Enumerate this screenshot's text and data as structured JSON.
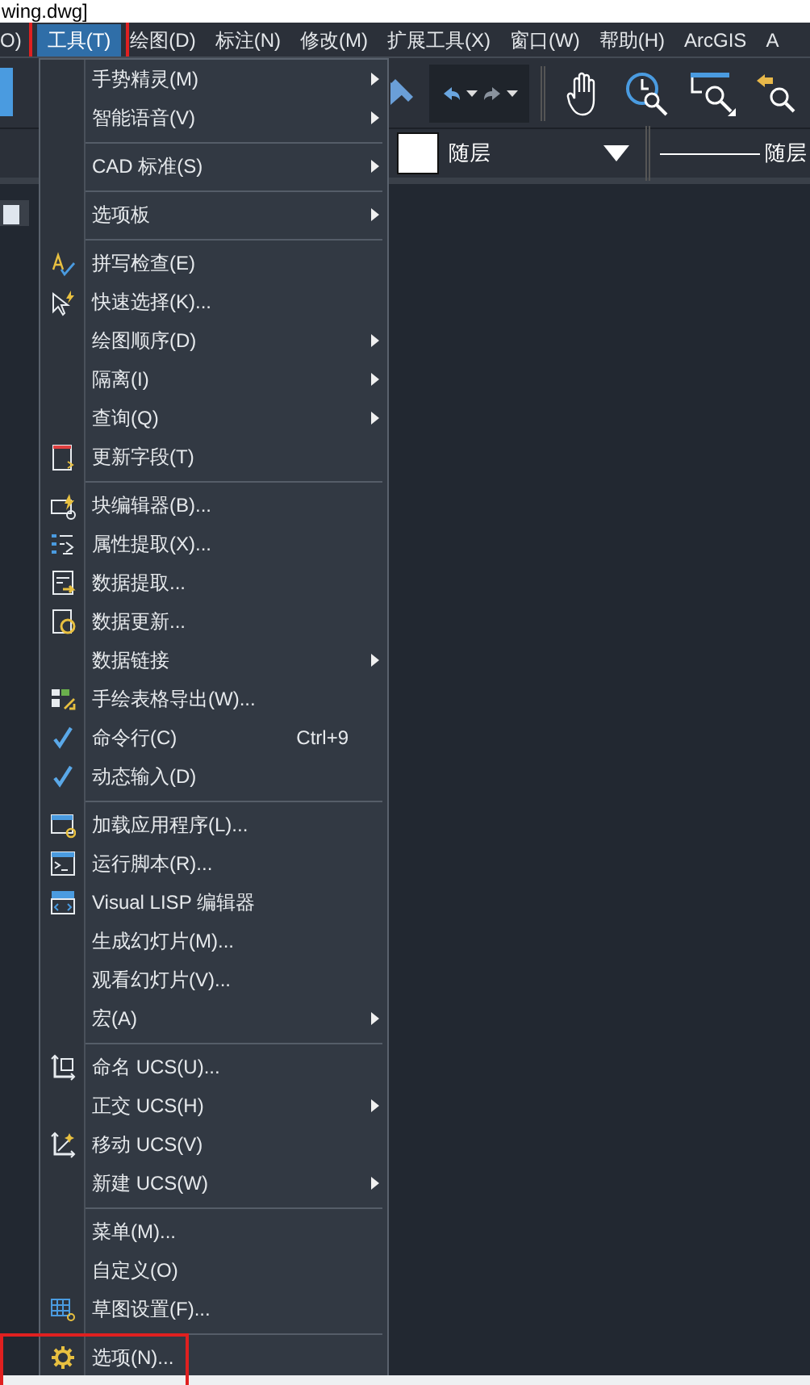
{
  "title_fragment": "wing.dwg]",
  "menubar": [
    {
      "label": "O)",
      "selected": false,
      "highlighted": false
    },
    {
      "label": "工具(T)",
      "selected": true,
      "highlighted": true
    },
    {
      "label": "绘图(D)",
      "selected": false,
      "highlighted": false
    },
    {
      "label": "标注(N)",
      "selected": false,
      "highlighted": false
    },
    {
      "label": "修改(M)",
      "selected": false,
      "highlighted": false
    },
    {
      "label": "扩展工具(X)",
      "selected": false,
      "highlighted": false
    },
    {
      "label": "窗口(W)",
      "selected": false,
      "highlighted": false
    },
    {
      "label": "帮助(H)",
      "selected": false,
      "highlighted": false
    },
    {
      "label": "ArcGIS",
      "selected": false,
      "highlighted": false
    },
    {
      "label": "A",
      "selected": false,
      "highlighted": false
    }
  ],
  "toolbar": {
    "layer_value": "随层",
    "linetype_value": "随层"
  },
  "menu": {
    "groups": [
      {
        "items": [
          {
            "kind": "text",
            "label": "手势精灵(M)",
            "submenu": true,
            "checked": false,
            "highlighted": false
          },
          {
            "kind": "text",
            "label": "智能语音(V)",
            "submenu": true,
            "checked": false,
            "highlighted": false
          }
        ]
      },
      {
        "items": [
          {
            "kind": "text",
            "label": "CAD 标准(S)",
            "submenu": true,
            "checked": false,
            "highlighted": false
          }
        ]
      },
      {
        "items": [
          {
            "kind": "text",
            "label": "选项板",
            "submenu": true,
            "checked": false,
            "highlighted": false
          }
        ]
      },
      {
        "items": [
          {
            "kind": "spell",
            "label": "拼写检查(E)",
            "submenu": false,
            "checked": false,
            "highlighted": false
          },
          {
            "kind": "cursor",
            "label": "快速选择(K)...",
            "submenu": false,
            "checked": false,
            "highlighted": false
          },
          {
            "kind": "text",
            "label": "绘图顺序(D)",
            "submenu": true,
            "checked": false,
            "highlighted": false
          },
          {
            "kind": "text",
            "label": "隔离(I)",
            "submenu": true,
            "checked": false,
            "highlighted": false
          },
          {
            "kind": "text",
            "label": "查询(Q)",
            "submenu": true,
            "checked": false,
            "highlighted": false
          },
          {
            "kind": "page",
            "label": "更新字段(T)",
            "submenu": false,
            "checked": false,
            "highlighted": false
          }
        ]
      },
      {
        "items": [
          {
            "kind": "block",
            "label": "块编辑器(B)...",
            "submenu": false,
            "checked": false,
            "highlighted": false
          },
          {
            "kind": "list",
            "label": "属性提取(X)...",
            "submenu": false,
            "checked": false,
            "highlighted": false
          },
          {
            "kind": "export",
            "label": "数据提取...",
            "submenu": false,
            "checked": false,
            "highlighted": false
          },
          {
            "kind": "refresh",
            "label": "数据更新...",
            "submenu": false,
            "checked": false,
            "highlighted": false
          },
          {
            "kind": "text",
            "label": "数据链接",
            "submenu": true,
            "checked": false,
            "highlighted": false
          },
          {
            "kind": "table",
            "label": "手绘表格导出(W)...",
            "submenu": false,
            "checked": false,
            "highlighted": false
          },
          {
            "kind": "text",
            "label": "命令行(C)",
            "shortcut": "Ctrl+9",
            "submenu": false,
            "checked": true,
            "highlighted": false
          },
          {
            "kind": "text",
            "label": "动态输入(D)",
            "submenu": false,
            "checked": true,
            "highlighted": false
          }
        ]
      },
      {
        "items": [
          {
            "kind": "app",
            "label": "加载应用程序(L)...",
            "submenu": false,
            "checked": false,
            "highlighted": false
          },
          {
            "kind": "console",
            "label": "运行脚本(R)...",
            "submenu": false,
            "checked": false,
            "highlighted": false
          },
          {
            "kind": "lisp",
            "label": "Visual LISP 编辑器",
            "submenu": false,
            "checked": false,
            "highlighted": false
          },
          {
            "kind": "text",
            "label": "生成幻灯片(M)...",
            "submenu": false,
            "checked": false,
            "highlighted": false
          },
          {
            "kind": "text",
            "label": "观看幻灯片(V)...",
            "submenu": false,
            "checked": false,
            "highlighted": false
          },
          {
            "kind": "text",
            "label": "宏(A)",
            "submenu": true,
            "checked": false,
            "highlighted": false
          }
        ]
      },
      {
        "items": [
          {
            "kind": "axes",
            "label": "命名 UCS(U)...",
            "submenu": false,
            "checked": false,
            "highlighted": false
          },
          {
            "kind": "text",
            "label": "正交 UCS(H)",
            "submenu": true,
            "checked": false,
            "highlighted": false
          },
          {
            "kind": "axes-move",
            "label": "移动 UCS(V)",
            "submenu": false,
            "checked": false,
            "highlighted": false
          },
          {
            "kind": "text",
            "label": "新建 UCS(W)",
            "submenu": true,
            "checked": false,
            "highlighted": false
          }
        ]
      },
      {
        "items": [
          {
            "kind": "text",
            "label": "菜单(M)...",
            "submenu": false,
            "checked": false,
            "highlighted": false
          },
          {
            "kind": "text",
            "label": "自定义(O)",
            "submenu": false,
            "checked": false,
            "highlighted": false
          },
          {
            "kind": "grid",
            "label": "草图设置(F)...",
            "submenu": false,
            "checked": false,
            "highlighted": false
          }
        ]
      },
      {
        "items": [
          {
            "kind": "gear",
            "label": "选项(N)...",
            "submenu": false,
            "checked": false,
            "highlighted": true
          }
        ]
      }
    ]
  }
}
